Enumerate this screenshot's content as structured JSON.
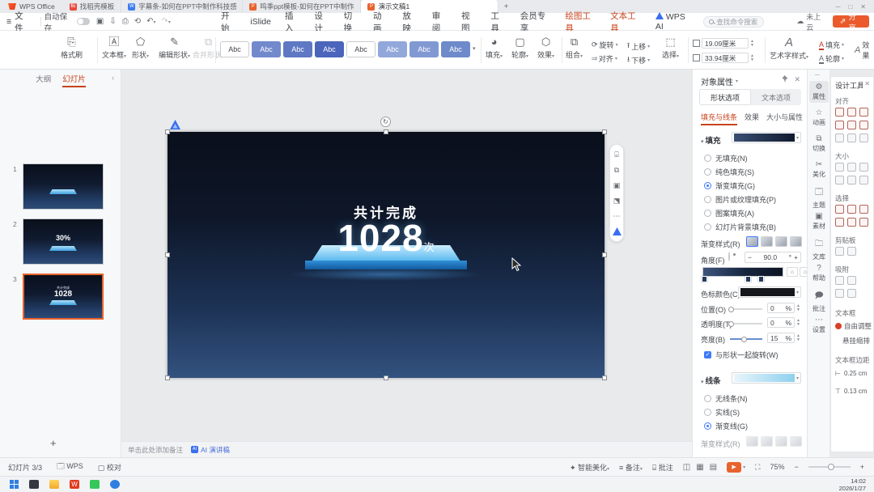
{
  "tabbar": {
    "home": "WPS Office",
    "tabs": [
      {
        "label": "找稻壳模板"
      },
      {
        "label": "字幕条-如何在PPT中制作科技感"
      },
      {
        "label": "鸣季ppt模板-如何在PPT中制作"
      },
      {
        "label": "演示文稿1"
      }
    ],
    "new_tab": "+"
  },
  "menubar": {
    "file": "文件",
    "autosave": "自动保存",
    "items": [
      "开始",
      "iSlide",
      "插入",
      "设计",
      "切换",
      "动画",
      "放映",
      "审阅",
      "视图",
      "工具",
      "会员专享",
      "绘图工具",
      "文本工具",
      "WPS AI"
    ],
    "search_placeholder": "查找命令搜索",
    "cloud": "未上云",
    "share": "分享"
  },
  "ribbon": {
    "format_painter": "格式刷",
    "text_box": "文本框",
    "shapes": "形状",
    "edit_shape": "编辑形状",
    "merge_shapes": "合并形状",
    "style_sample": "Abc",
    "fill": "填充",
    "outline": "轮廓",
    "effects": "效果",
    "group": "组合",
    "rotate": "旋转",
    "align": "对齐",
    "bring_forward": "上移",
    "send_backward": "下移",
    "select": "选择",
    "height_value": "19.09厘米",
    "width_value": "33.94厘米",
    "wordart": "艺术字样式",
    "text_fill": "填充",
    "text_outline": "轮廓",
    "text_effects": "效果"
  },
  "slides_pane": {
    "tab_outline": "大纲",
    "tab_slides": "幻灯片",
    "slides": [
      {
        "num": "1",
        "big": "",
        "caption": ""
      },
      {
        "num": "2",
        "big": "30%",
        "caption": ""
      },
      {
        "num": "3",
        "big": "1028",
        "caption": "共计完成"
      }
    ],
    "add": "+"
  },
  "canvas": {
    "title": "共计完成",
    "number": "1028",
    "unit": "次"
  },
  "object_panel": {
    "title": "对象属性",
    "tab_shape": "形状选项",
    "tab_text": "文本选项",
    "sub_fill": "填充与线条",
    "sub_effects": "效果",
    "sub_size": "大小与属性",
    "fill_header": "填充",
    "fill_options": [
      "无填充(N)",
      "纯色填充(S)",
      "渐变填充(G)",
      "图片或纹理填充(P)",
      "图案填充(A)",
      "幻灯片背景填充(B)"
    ],
    "gradient_style": "渐变样式(R)",
    "angle_label": "角度(F)",
    "angle_value": "90.0",
    "degree": "°",
    "stop_color": "色标颜色(C)",
    "position_label": "位置(O)",
    "position_value": "0",
    "transparency_label": "透明度(T)",
    "transparency_value": "0",
    "brightness_label": "亮度(B)",
    "brightness_value": "15",
    "percent": "%",
    "rotate_with_shape": "与形状一起旋转(W)",
    "line_header": "线条",
    "line_options": [
      "无线条(N)",
      "实线(S)",
      "渐变线(G)"
    ],
    "line_gradient_style": "渐变样式(R)"
  },
  "right_strip": {
    "items": [
      "属性",
      "动画",
      "切换",
      "美化",
      "主题",
      "素材",
      "文库",
      "帮助",
      "批注",
      "设置"
    ]
  },
  "design_panel": {
    "title": "设计工具",
    "align": "对齐",
    "size": "大小",
    "select": "选择",
    "clipboard": "剪贴板",
    "snap": "吸附",
    "textbox": "文本框",
    "free_adjust": "自由调整",
    "indent": "悬挂缩排",
    "textbox_margin": "文本框边距",
    "margin_h": "0.25 cm",
    "margin_v": "0.13 cm"
  },
  "notes": {
    "placeholder": "单击此处添加备注",
    "ai_script": "AI 演讲稿"
  },
  "statusbar": {
    "slide_indicator": "幻灯片 3/3",
    "wps": "WPS",
    "proofread": "校对",
    "beautify": "智能美化",
    "note": "备注",
    "comment": "批注",
    "zoom": "75%"
  },
  "taskbar": {
    "time": "14:02",
    "date": "2026/1/27"
  },
  "icons": {
    "minimize": "─",
    "maximize": "□",
    "close": "✕"
  }
}
